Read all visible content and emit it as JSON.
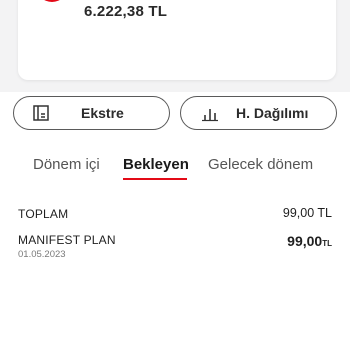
{
  "balance_card": {
    "amount": "6.222,38 TL",
    "brand_color": "#e30a17"
  },
  "actions": {
    "statement": {
      "label": "Ekstre",
      "icon": "statement-icon"
    },
    "spending": {
      "label": "H. Dağılımı",
      "icon": "bar-chart-icon"
    }
  },
  "tabs": [
    {
      "label": "Dönem içi",
      "active": false
    },
    {
      "label": "Bekleyen",
      "active": true
    },
    {
      "label": "Gelecek dönem",
      "active": false
    }
  ],
  "summary": {
    "label": "TOPLAM",
    "amount": "99,00 TL"
  },
  "transactions": [
    {
      "title": "MANIFEST PLAN",
      "date": "01.05.2023",
      "amount_main": "99,00",
      "currency": "TL"
    }
  ],
  "accent_color": "#e30a17"
}
